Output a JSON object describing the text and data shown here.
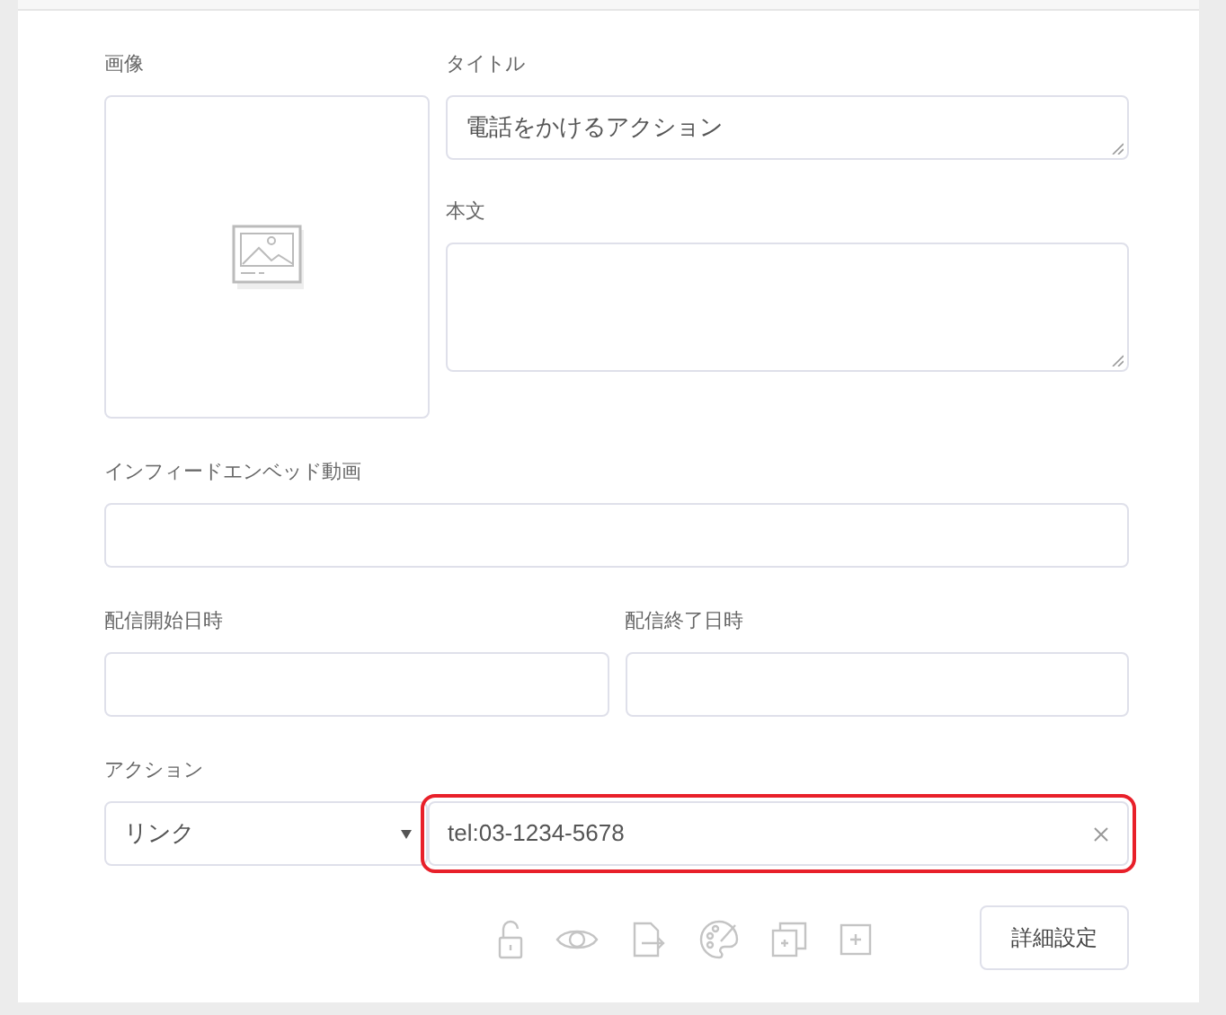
{
  "image": {
    "label": "画像"
  },
  "title": {
    "label": "タイトル",
    "value": "電話をかけるアクション"
  },
  "body": {
    "label": "本文"
  },
  "infeed_video": {
    "label": "インフィードエンベッド動画"
  },
  "start_date": {
    "label": "配信開始日時"
  },
  "end_date": {
    "label": "配信終了日時"
  },
  "action": {
    "label": "アクション",
    "type": "リンク",
    "url": "tel:03-1234-5678",
    "highlighted": true
  },
  "toolbar": [
    {
      "kind": "lock"
    },
    {
      "kind": "eye"
    },
    {
      "kind": "export"
    },
    {
      "kind": "palette"
    },
    {
      "kind": "duplicate"
    },
    {
      "kind": "add"
    }
  ],
  "settings_button": "詳細設定"
}
